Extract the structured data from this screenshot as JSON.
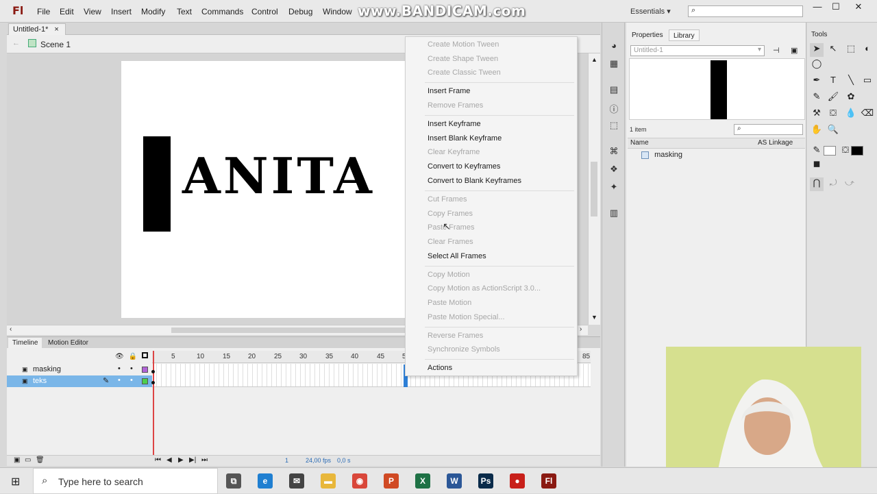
{
  "app": {
    "logo": "Fl",
    "menu": [
      "File",
      "Edit",
      "View",
      "Insert",
      "Modify",
      "Text",
      "Commands",
      "Control",
      "Debug",
      "Window"
    ],
    "watermark": "www.BANDICAM.com",
    "workspace": "Essentials",
    "window_controls": [
      "—",
      "☐",
      "✕"
    ]
  },
  "document": {
    "tab_label": "Untitled-1*",
    "tab_close": "×",
    "scene_label": "Scene 1"
  },
  "stage": {
    "text": "ANITA"
  },
  "context_menu": {
    "items": [
      {
        "label": "Create Motion Tween",
        "enabled": false
      },
      {
        "label": "Create Shape Tween",
        "enabled": false
      },
      {
        "label": "Create Classic Tween",
        "enabled": false
      },
      {
        "label": "Insert Frame",
        "enabled": true
      },
      {
        "label": "Remove Frames",
        "enabled": false
      },
      {
        "label": "Insert Keyframe",
        "enabled": true
      },
      {
        "label": "Insert Blank Keyframe",
        "enabled": true
      },
      {
        "label": "Clear Keyframe",
        "enabled": false
      },
      {
        "label": "Convert to Keyframes",
        "enabled": true
      },
      {
        "label": "Convert to Blank Keyframes",
        "enabled": true
      },
      {
        "label": "Cut Frames",
        "enabled": false
      },
      {
        "label": "Copy Frames",
        "enabled": false
      },
      {
        "label": "Paste Frames",
        "enabled": false
      },
      {
        "label": "Clear Frames",
        "enabled": false
      },
      {
        "label": "Select All Frames",
        "enabled": true
      },
      {
        "label": "Copy Motion",
        "enabled": false
      },
      {
        "label": "Copy Motion as ActionScript 3.0...",
        "enabled": false
      },
      {
        "label": "Paste Motion",
        "enabled": false
      },
      {
        "label": "Paste Motion Special...",
        "enabled": false
      },
      {
        "label": "Reverse Frames",
        "enabled": false
      },
      {
        "label": "Synchronize Symbols",
        "enabled": false
      },
      {
        "label": "Actions",
        "enabled": true
      }
    ]
  },
  "timeline": {
    "tabs": [
      "Timeline",
      "Motion Editor"
    ],
    "frame_numbers": [
      "5",
      "10",
      "15",
      "20",
      "25",
      "30",
      "35",
      "40",
      "45",
      "5",
      "85"
    ],
    "layers": [
      {
        "name": "masking",
        "selected": false
      },
      {
        "name": "teks",
        "selected": true
      }
    ],
    "frame_rate": "24,00 fps",
    "elapsed": "0,0 s",
    "current_frame": "1"
  },
  "library": {
    "tabs": [
      "Properties",
      "Library"
    ],
    "document_select": "Untitled-1",
    "item_count": "1 item",
    "columns": {
      "name": "Name",
      "linkage": "AS Linkage"
    },
    "items": [
      "masking"
    ]
  },
  "tools": {
    "title": "Tools"
  },
  "taskbar": {
    "search_placeholder": "Type here to search",
    "apps": [
      {
        "name": "task-view",
        "glyph": "⧉",
        "color": "#555555"
      },
      {
        "name": "edge",
        "glyph": "e",
        "color": "#1f7fd1"
      },
      {
        "name": "mail",
        "glyph": "✉",
        "color": "#444444"
      },
      {
        "name": "explorer",
        "glyph": "▬",
        "color": "#e8b73b"
      },
      {
        "name": "chrome",
        "glyph": "◉",
        "color": "#d9473a"
      },
      {
        "name": "powerpoint",
        "glyph": "P",
        "color": "#d04a24"
      },
      {
        "name": "excel",
        "glyph": "X",
        "color": "#1e7145"
      },
      {
        "name": "word",
        "glyph": "W",
        "color": "#2b5797"
      },
      {
        "name": "photoshop",
        "glyph": "Ps",
        "color": "#0a2b4a"
      },
      {
        "name": "bandicam",
        "glyph": "●",
        "color": "#c8201a"
      },
      {
        "name": "flash",
        "glyph": "Fl",
        "color": "#8a1a12"
      }
    ]
  }
}
